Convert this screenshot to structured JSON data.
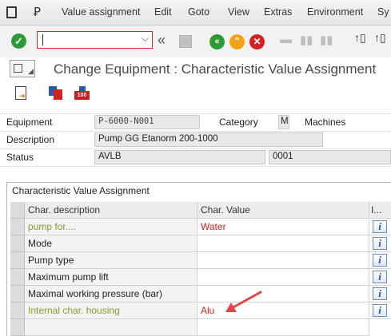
{
  "menu": {
    "items": [
      "Value assignment",
      "Edit",
      "Goto",
      "View",
      "Extras",
      "Environment",
      "Sy"
    ]
  },
  "toolbar": {
    "command_field": "",
    "icons": [
      "checkmark-icon",
      "back-double-icon",
      "save-icon",
      "back-icon",
      "exit-icon",
      "cancel-icon",
      "print-icon",
      "find-icon",
      "find-next-icon",
      "first-page-icon",
      "prev-page-icon"
    ]
  },
  "title": "Change Equipment : Characteristic Value Assignment",
  "header": {
    "equipment_label": "Equipment",
    "equipment_value": "P-6000-N001",
    "category_label": "Category",
    "category_value": "M",
    "category_text": "Machines",
    "description_label": "Description",
    "description_value": "Pump GG  Etanorm 200-1000",
    "status_label": "Status",
    "status_value": "AVLB",
    "status_code": "0001"
  },
  "section": {
    "title": "Characteristic Value Assignment"
  },
  "table": {
    "columns": [
      "Char. description",
      "Char. Value",
      "I..."
    ],
    "rows": [
      {
        "desc": "pump for....",
        "value": "Water"
      },
      {
        "desc": "Mode",
        "value": ""
      },
      {
        "desc": "Pump type",
        "value": ""
      },
      {
        "desc": "Maximum pump lift",
        "value": ""
      },
      {
        "desc": "Maximal working pressure (bar)",
        "value": ""
      },
      {
        "desc": "Internal char. housing",
        "value": "Alu"
      },
      {
        "desc": "",
        "value": ""
      }
    ]
  },
  "colors": {
    "required_desc": "#8a9a2a",
    "value_red": "#d42020",
    "arrow": "#e04848"
  }
}
